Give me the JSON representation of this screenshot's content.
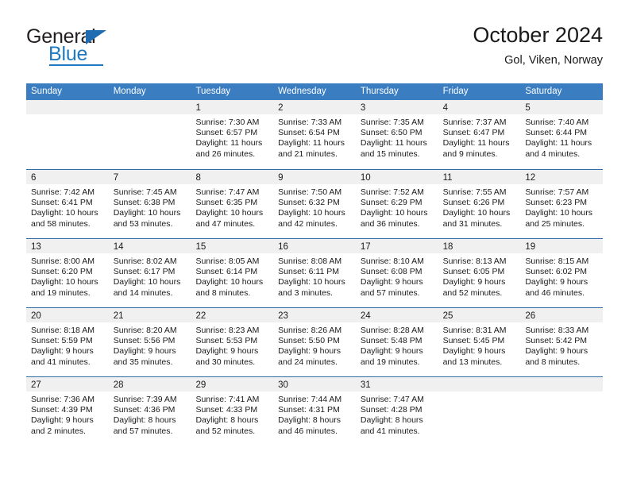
{
  "brand": {
    "name_top": "General",
    "name_bottom": "Blue",
    "triangle_icon": "blue-triangle-icon",
    "colors": {
      "dark": "#231f20",
      "blue": "#1f7ac0"
    }
  },
  "header": {
    "title": "October 2024",
    "subtitle": "Gol, Viken, Norway"
  },
  "theme": {
    "header_blue": "#3a7dc0",
    "row_divider": "#2f6ca8",
    "day_band": "#f0f0f0"
  },
  "weekdays": [
    "Sunday",
    "Monday",
    "Tuesday",
    "Wednesday",
    "Thursday",
    "Friday",
    "Saturday"
  ],
  "weeks": [
    [
      {
        "empty": true
      },
      {
        "empty": true
      },
      {
        "day": "1",
        "sunrise": "Sunrise: 7:30 AM",
        "sunset": "Sunset: 6:57 PM",
        "daylight": "Daylight: 11 hours and 26 minutes."
      },
      {
        "day": "2",
        "sunrise": "Sunrise: 7:33 AM",
        "sunset": "Sunset: 6:54 PM",
        "daylight": "Daylight: 11 hours and 21 minutes."
      },
      {
        "day": "3",
        "sunrise": "Sunrise: 7:35 AM",
        "sunset": "Sunset: 6:50 PM",
        "daylight": "Daylight: 11 hours and 15 minutes."
      },
      {
        "day": "4",
        "sunrise": "Sunrise: 7:37 AM",
        "sunset": "Sunset: 6:47 PM",
        "daylight": "Daylight: 11 hours and 9 minutes."
      },
      {
        "day": "5",
        "sunrise": "Sunrise: 7:40 AM",
        "sunset": "Sunset: 6:44 PM",
        "daylight": "Daylight: 11 hours and 4 minutes."
      }
    ],
    [
      {
        "day": "6",
        "sunrise": "Sunrise: 7:42 AM",
        "sunset": "Sunset: 6:41 PM",
        "daylight": "Daylight: 10 hours and 58 minutes."
      },
      {
        "day": "7",
        "sunrise": "Sunrise: 7:45 AM",
        "sunset": "Sunset: 6:38 PM",
        "daylight": "Daylight: 10 hours and 53 minutes."
      },
      {
        "day": "8",
        "sunrise": "Sunrise: 7:47 AM",
        "sunset": "Sunset: 6:35 PM",
        "daylight": "Daylight: 10 hours and 47 minutes."
      },
      {
        "day": "9",
        "sunrise": "Sunrise: 7:50 AM",
        "sunset": "Sunset: 6:32 PM",
        "daylight": "Daylight: 10 hours and 42 minutes."
      },
      {
        "day": "10",
        "sunrise": "Sunrise: 7:52 AM",
        "sunset": "Sunset: 6:29 PM",
        "daylight": "Daylight: 10 hours and 36 minutes."
      },
      {
        "day": "11",
        "sunrise": "Sunrise: 7:55 AM",
        "sunset": "Sunset: 6:26 PM",
        "daylight": "Daylight: 10 hours and 31 minutes."
      },
      {
        "day": "12",
        "sunrise": "Sunrise: 7:57 AM",
        "sunset": "Sunset: 6:23 PM",
        "daylight": "Daylight: 10 hours and 25 minutes."
      }
    ],
    [
      {
        "day": "13",
        "sunrise": "Sunrise: 8:00 AM",
        "sunset": "Sunset: 6:20 PM",
        "daylight": "Daylight: 10 hours and 19 minutes."
      },
      {
        "day": "14",
        "sunrise": "Sunrise: 8:02 AM",
        "sunset": "Sunset: 6:17 PM",
        "daylight": "Daylight: 10 hours and 14 minutes."
      },
      {
        "day": "15",
        "sunrise": "Sunrise: 8:05 AM",
        "sunset": "Sunset: 6:14 PM",
        "daylight": "Daylight: 10 hours and 8 minutes."
      },
      {
        "day": "16",
        "sunrise": "Sunrise: 8:08 AM",
        "sunset": "Sunset: 6:11 PM",
        "daylight": "Daylight: 10 hours and 3 minutes."
      },
      {
        "day": "17",
        "sunrise": "Sunrise: 8:10 AM",
        "sunset": "Sunset: 6:08 PM",
        "daylight": "Daylight: 9 hours and 57 minutes."
      },
      {
        "day": "18",
        "sunrise": "Sunrise: 8:13 AM",
        "sunset": "Sunset: 6:05 PM",
        "daylight": "Daylight: 9 hours and 52 minutes."
      },
      {
        "day": "19",
        "sunrise": "Sunrise: 8:15 AM",
        "sunset": "Sunset: 6:02 PM",
        "daylight": "Daylight: 9 hours and 46 minutes."
      }
    ],
    [
      {
        "day": "20",
        "sunrise": "Sunrise: 8:18 AM",
        "sunset": "Sunset: 5:59 PM",
        "daylight": "Daylight: 9 hours and 41 minutes."
      },
      {
        "day": "21",
        "sunrise": "Sunrise: 8:20 AM",
        "sunset": "Sunset: 5:56 PM",
        "daylight": "Daylight: 9 hours and 35 minutes."
      },
      {
        "day": "22",
        "sunrise": "Sunrise: 8:23 AM",
        "sunset": "Sunset: 5:53 PM",
        "daylight": "Daylight: 9 hours and 30 minutes."
      },
      {
        "day": "23",
        "sunrise": "Sunrise: 8:26 AM",
        "sunset": "Sunset: 5:50 PM",
        "daylight": "Daylight: 9 hours and 24 minutes."
      },
      {
        "day": "24",
        "sunrise": "Sunrise: 8:28 AM",
        "sunset": "Sunset: 5:48 PM",
        "daylight": "Daylight: 9 hours and 19 minutes."
      },
      {
        "day": "25",
        "sunrise": "Sunrise: 8:31 AM",
        "sunset": "Sunset: 5:45 PM",
        "daylight": "Daylight: 9 hours and 13 minutes."
      },
      {
        "day": "26",
        "sunrise": "Sunrise: 8:33 AM",
        "sunset": "Sunset: 5:42 PM",
        "daylight": "Daylight: 9 hours and 8 minutes."
      }
    ],
    [
      {
        "day": "27",
        "sunrise": "Sunrise: 7:36 AM",
        "sunset": "Sunset: 4:39 PM",
        "daylight": "Daylight: 9 hours and 2 minutes."
      },
      {
        "day": "28",
        "sunrise": "Sunrise: 7:39 AM",
        "sunset": "Sunset: 4:36 PM",
        "daylight": "Daylight: 8 hours and 57 minutes."
      },
      {
        "day": "29",
        "sunrise": "Sunrise: 7:41 AM",
        "sunset": "Sunset: 4:33 PM",
        "daylight": "Daylight: 8 hours and 52 minutes."
      },
      {
        "day": "30",
        "sunrise": "Sunrise: 7:44 AM",
        "sunset": "Sunset: 4:31 PM",
        "daylight": "Daylight: 8 hours and 46 minutes."
      },
      {
        "day": "31",
        "sunrise": "Sunrise: 7:47 AM",
        "sunset": "Sunset: 4:28 PM",
        "daylight": "Daylight: 8 hours and 41 minutes."
      },
      {
        "empty": true
      },
      {
        "empty": true
      }
    ]
  ]
}
